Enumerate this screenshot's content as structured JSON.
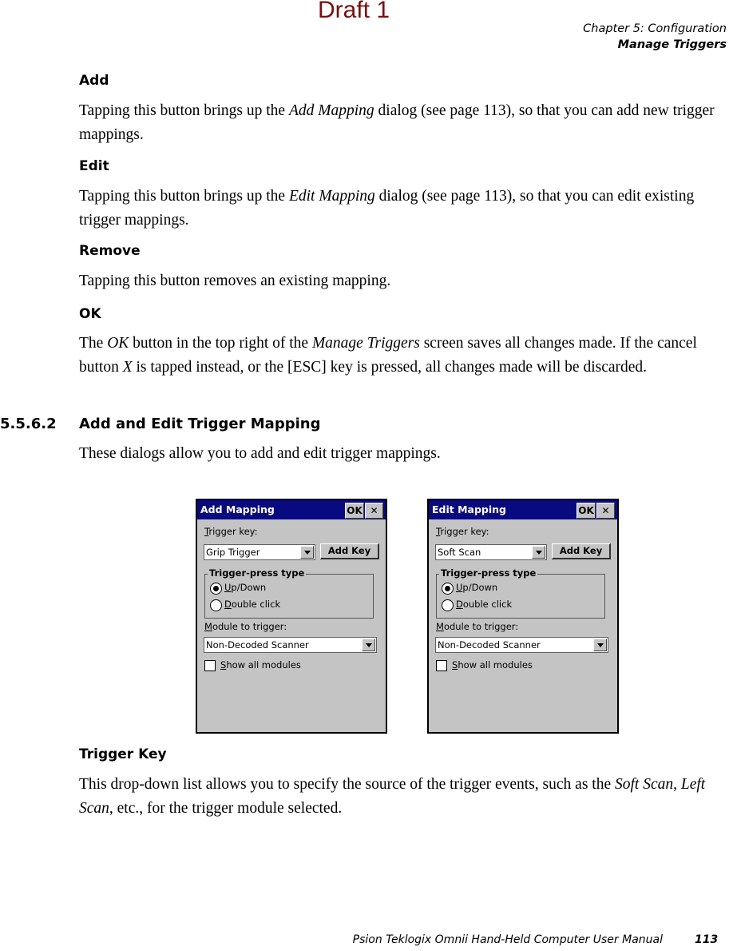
{
  "watermark": "Draft 1",
  "header": {
    "chapter": "Chapter 5: Configuration",
    "section": "Manage Triggers"
  },
  "sections": [
    {
      "heading": "Add",
      "body_pre": "Tapping this button brings up the ",
      "body_em": "Add Mapping",
      "body_post": " dialog (see page 113), so that you can add new trigger mappings."
    },
    {
      "heading": "Edit",
      "body_pre": "Tapping this button brings up the ",
      "body_em": "Edit Mapping",
      "body_post": " dialog (see page 113), so that you can edit existing trigger mappings."
    },
    {
      "heading": "Remove",
      "body": "Tapping this button removes an existing mapping."
    },
    {
      "heading": "OK",
      "t1": "The ",
      "e1": "OK",
      "t2": " button in the top right of the ",
      "e2": "Manage Triggers",
      "t3": " screen saves all changes made. If the cancel button ",
      "e3": "X",
      "t4": " is tapped instead, or the [ESC] key is pressed, all changes made will be discarded."
    }
  ],
  "subsection": {
    "number": "5.5.6.2",
    "title": "Add and Edit Trigger Mapping",
    "intro": "These dialogs allow you to add and edit trigger mappings."
  },
  "dialogs": [
    {
      "title": "Add Mapping",
      "ok": "OK",
      "close": "✕",
      "trigger_key_label_u": "T",
      "trigger_key_label": "rigger key:",
      "trigger_key_value": "Grip Trigger",
      "add_key": "Add Key",
      "group_title": "Trigger-press type",
      "radio1_u": "U",
      "radio1": "p/Down",
      "radio1_selected": true,
      "radio2_u": "D",
      "radio2": "ouble click",
      "radio2_selected": false,
      "module_label_u": "M",
      "module_label": "odule to trigger:",
      "module_value": "Non-Decoded Scanner",
      "show_all_u": "S",
      "show_all": "how all modules",
      "show_all_checked": false
    },
    {
      "title": "Edit Mapping",
      "ok": "OK",
      "close": "✕",
      "trigger_key_label_u": "T",
      "trigger_key_label": "rigger key:",
      "trigger_key_value": "Soft Scan",
      "add_key": "Add Key",
      "group_title": "Trigger-press type",
      "radio1_u": "U",
      "radio1": "p/Down",
      "radio1_selected": true,
      "radio2_u": "D",
      "radio2": "ouble click",
      "radio2_selected": false,
      "module_label_u": "M",
      "module_label": "odule to trigger:",
      "module_value": "Non-Decoded Scanner",
      "show_all_u": "S",
      "show_all": "how all modules",
      "show_all_checked": false
    }
  ],
  "trigger_key_section": {
    "heading": "Trigger Key",
    "t1": "This drop-down list allows you to specify the source of the trigger events, such as the ",
    "e1": "Soft Scan",
    "t2": ", ",
    "e2": "Left Scan",
    "t3": ", etc., for the trigger module selected."
  },
  "footer": {
    "manual": "Psion Teklogix Omnii Hand-Held Computer User Manual",
    "page": "113"
  }
}
